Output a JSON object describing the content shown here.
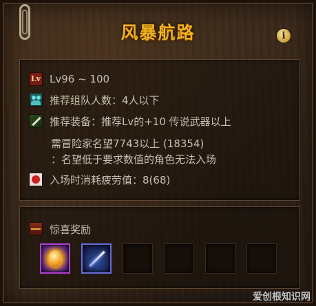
{
  "dungeon": {
    "title": "风暴航路",
    "level_range": "Lv96 ~ 100",
    "recommended_party": "推荐组队人数：4人以下",
    "recommended_gear": "推荐装备：推荐Lv的+10 传说武器以上",
    "fame_requirement": "需冒险家名望7743以上 (18354)",
    "fame_note": "：名望低于要求数值的角色无法入场",
    "fatigue_cost": "入场时消耗疲劳值：8(68)"
  },
  "rewards": {
    "label": "惊喜奖励",
    "slots": [
      {
        "icon": "golden-egg-icon",
        "filled": true
      },
      {
        "icon": "spear-icon",
        "filled": true
      },
      {
        "icon": "",
        "filled": false
      },
      {
        "icon": "",
        "filled": false
      },
      {
        "icon": "",
        "filled": false
      },
      {
        "icon": "",
        "filled": false
      }
    ]
  },
  "colors": {
    "title": "#f0b020",
    "text": "#c8c0ac",
    "rare_border": "#b040d0"
  },
  "watermark": "爱创根知识网"
}
